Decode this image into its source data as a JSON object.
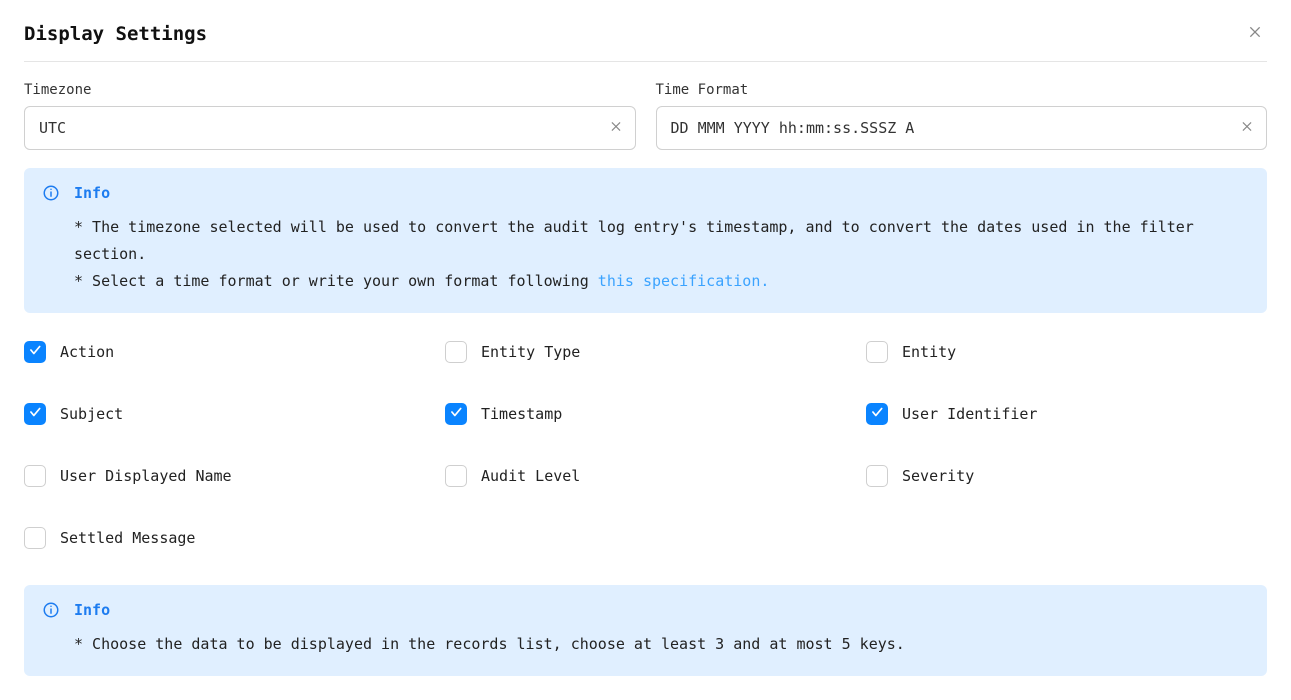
{
  "title": "Display Settings",
  "fields": {
    "timezone": {
      "label": "Timezone",
      "value": "UTC"
    },
    "timeformat": {
      "label": "Time Format",
      "value": "DD MMM YYYY hh:mm:ss.SSSZ A"
    }
  },
  "info1": {
    "title": "Info",
    "line1": "* The timezone selected will be used to convert the audit log entry's timestamp, and to convert the dates used in the filter section.",
    "line2a": "* Select a time format or write your own format following ",
    "link": "this specification."
  },
  "checkboxes": [
    {
      "label": "Action",
      "checked": true
    },
    {
      "label": "Entity Type",
      "checked": false
    },
    {
      "label": "Entity",
      "checked": false
    },
    {
      "label": "Subject",
      "checked": true
    },
    {
      "label": "Timestamp",
      "checked": true
    },
    {
      "label": "User Identifier",
      "checked": true
    },
    {
      "label": "User Displayed Name",
      "checked": false
    },
    {
      "label": "Audit Level",
      "checked": false
    },
    {
      "label": "Severity",
      "checked": false
    },
    {
      "label": "Settled Message",
      "checked": false
    }
  ],
  "info2": {
    "title": "Info",
    "body": "* Choose the data to be displayed in the records list, choose at least 3 and at most 5 keys."
  }
}
